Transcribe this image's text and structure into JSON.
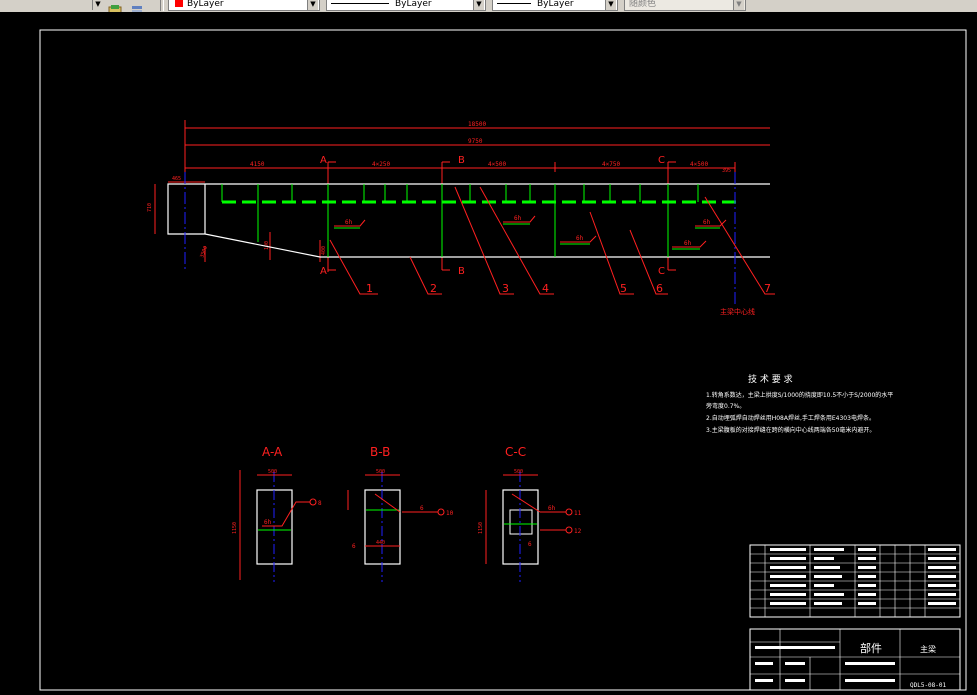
{
  "toolbar": {
    "color_value": "ByLayer",
    "linetype_value": "ByLayer",
    "lineweight_value": "ByLayer",
    "plotstyle_value": "随颜色"
  },
  "colors": {
    "accent_red": "#ff2020",
    "green": "#00ff00",
    "blue": "#2020ff",
    "white": "#ffffff",
    "title_text": "#ffffff"
  },
  "drawing": {
    "dims": {
      "overall": "18500",
      "second": "9750",
      "seg1": "4150",
      "seg2": "4×250",
      "seg3": "4×500",
      "seg4": "4×750",
      "seg5": "4×500",
      "left_width": "465",
      "left_height": "710",
      "slope": "3500",
      "end": "395",
      "wall1": "190",
      "wall2": "400"
    },
    "sections": {
      "a": "A",
      "b": "B",
      "c": "C"
    },
    "welds": [
      "6h",
      "6h",
      "6h",
      "6h",
      "6h"
    ],
    "balloons": [
      "1",
      "2",
      "3",
      "4",
      "5",
      "6",
      "7"
    ],
    "centerline_note": "主梁中心线",
    "section_titles": [
      "A-A",
      "B-B",
      "C-C"
    ],
    "section_dims": {
      "aa_width": "500",
      "aa_height": "1150",
      "bb_width": "500",
      "bb_inner": "440",
      "cc_width": "500",
      "cc_height": "1150"
    },
    "section_labels": [
      "8",
      "6",
      "10",
      "11",
      "12",
      "6",
      "6",
      "6h",
      "6h"
    ]
  },
  "tech_requirements": {
    "title": "技 术 要 求",
    "line1": "1.转角系数达，主梁上拱度S/1000的挠度即10.5不小于S/2000的水平",
    "line2": "旁弯度0.7%。",
    "line3": "2.自动埋弧焊自动焊丝用H08A焊丝,手工焊条用E4303电焊条。",
    "line4": "3.主梁腹板的对接焊缝在跨的横向中心线两端各50毫米内避开。"
  },
  "title_block": {
    "part_label": "部件",
    "name": "主梁",
    "drawing_no": "QDL5-08-01"
  }
}
